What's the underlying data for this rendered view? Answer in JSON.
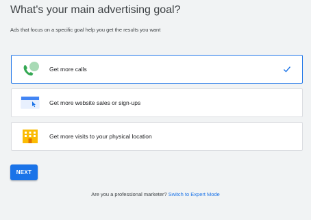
{
  "header": {
    "title": "What's your main advertising goal?",
    "subtitle": "Ads that focus on a specific goal help you get the results you want"
  },
  "options": [
    {
      "label": "Get more calls",
      "icon": "phone-icon",
      "selected": true
    },
    {
      "label": "Get more website sales or sign-ups",
      "icon": "browser-window-icon",
      "selected": false
    },
    {
      "label": "Get more visits to your physical location",
      "icon": "building-icon",
      "selected": false
    }
  ],
  "actions": {
    "next_label": "NEXT"
  },
  "footer": {
    "prompt": "Are you a professional marketer?",
    "link_label": "Switch to Expert Mode"
  },
  "colors": {
    "accent": "#1a73e8",
    "phone_green": "#34a853",
    "building_yellow": "#fbbc04",
    "background": "#f1f3f4"
  }
}
